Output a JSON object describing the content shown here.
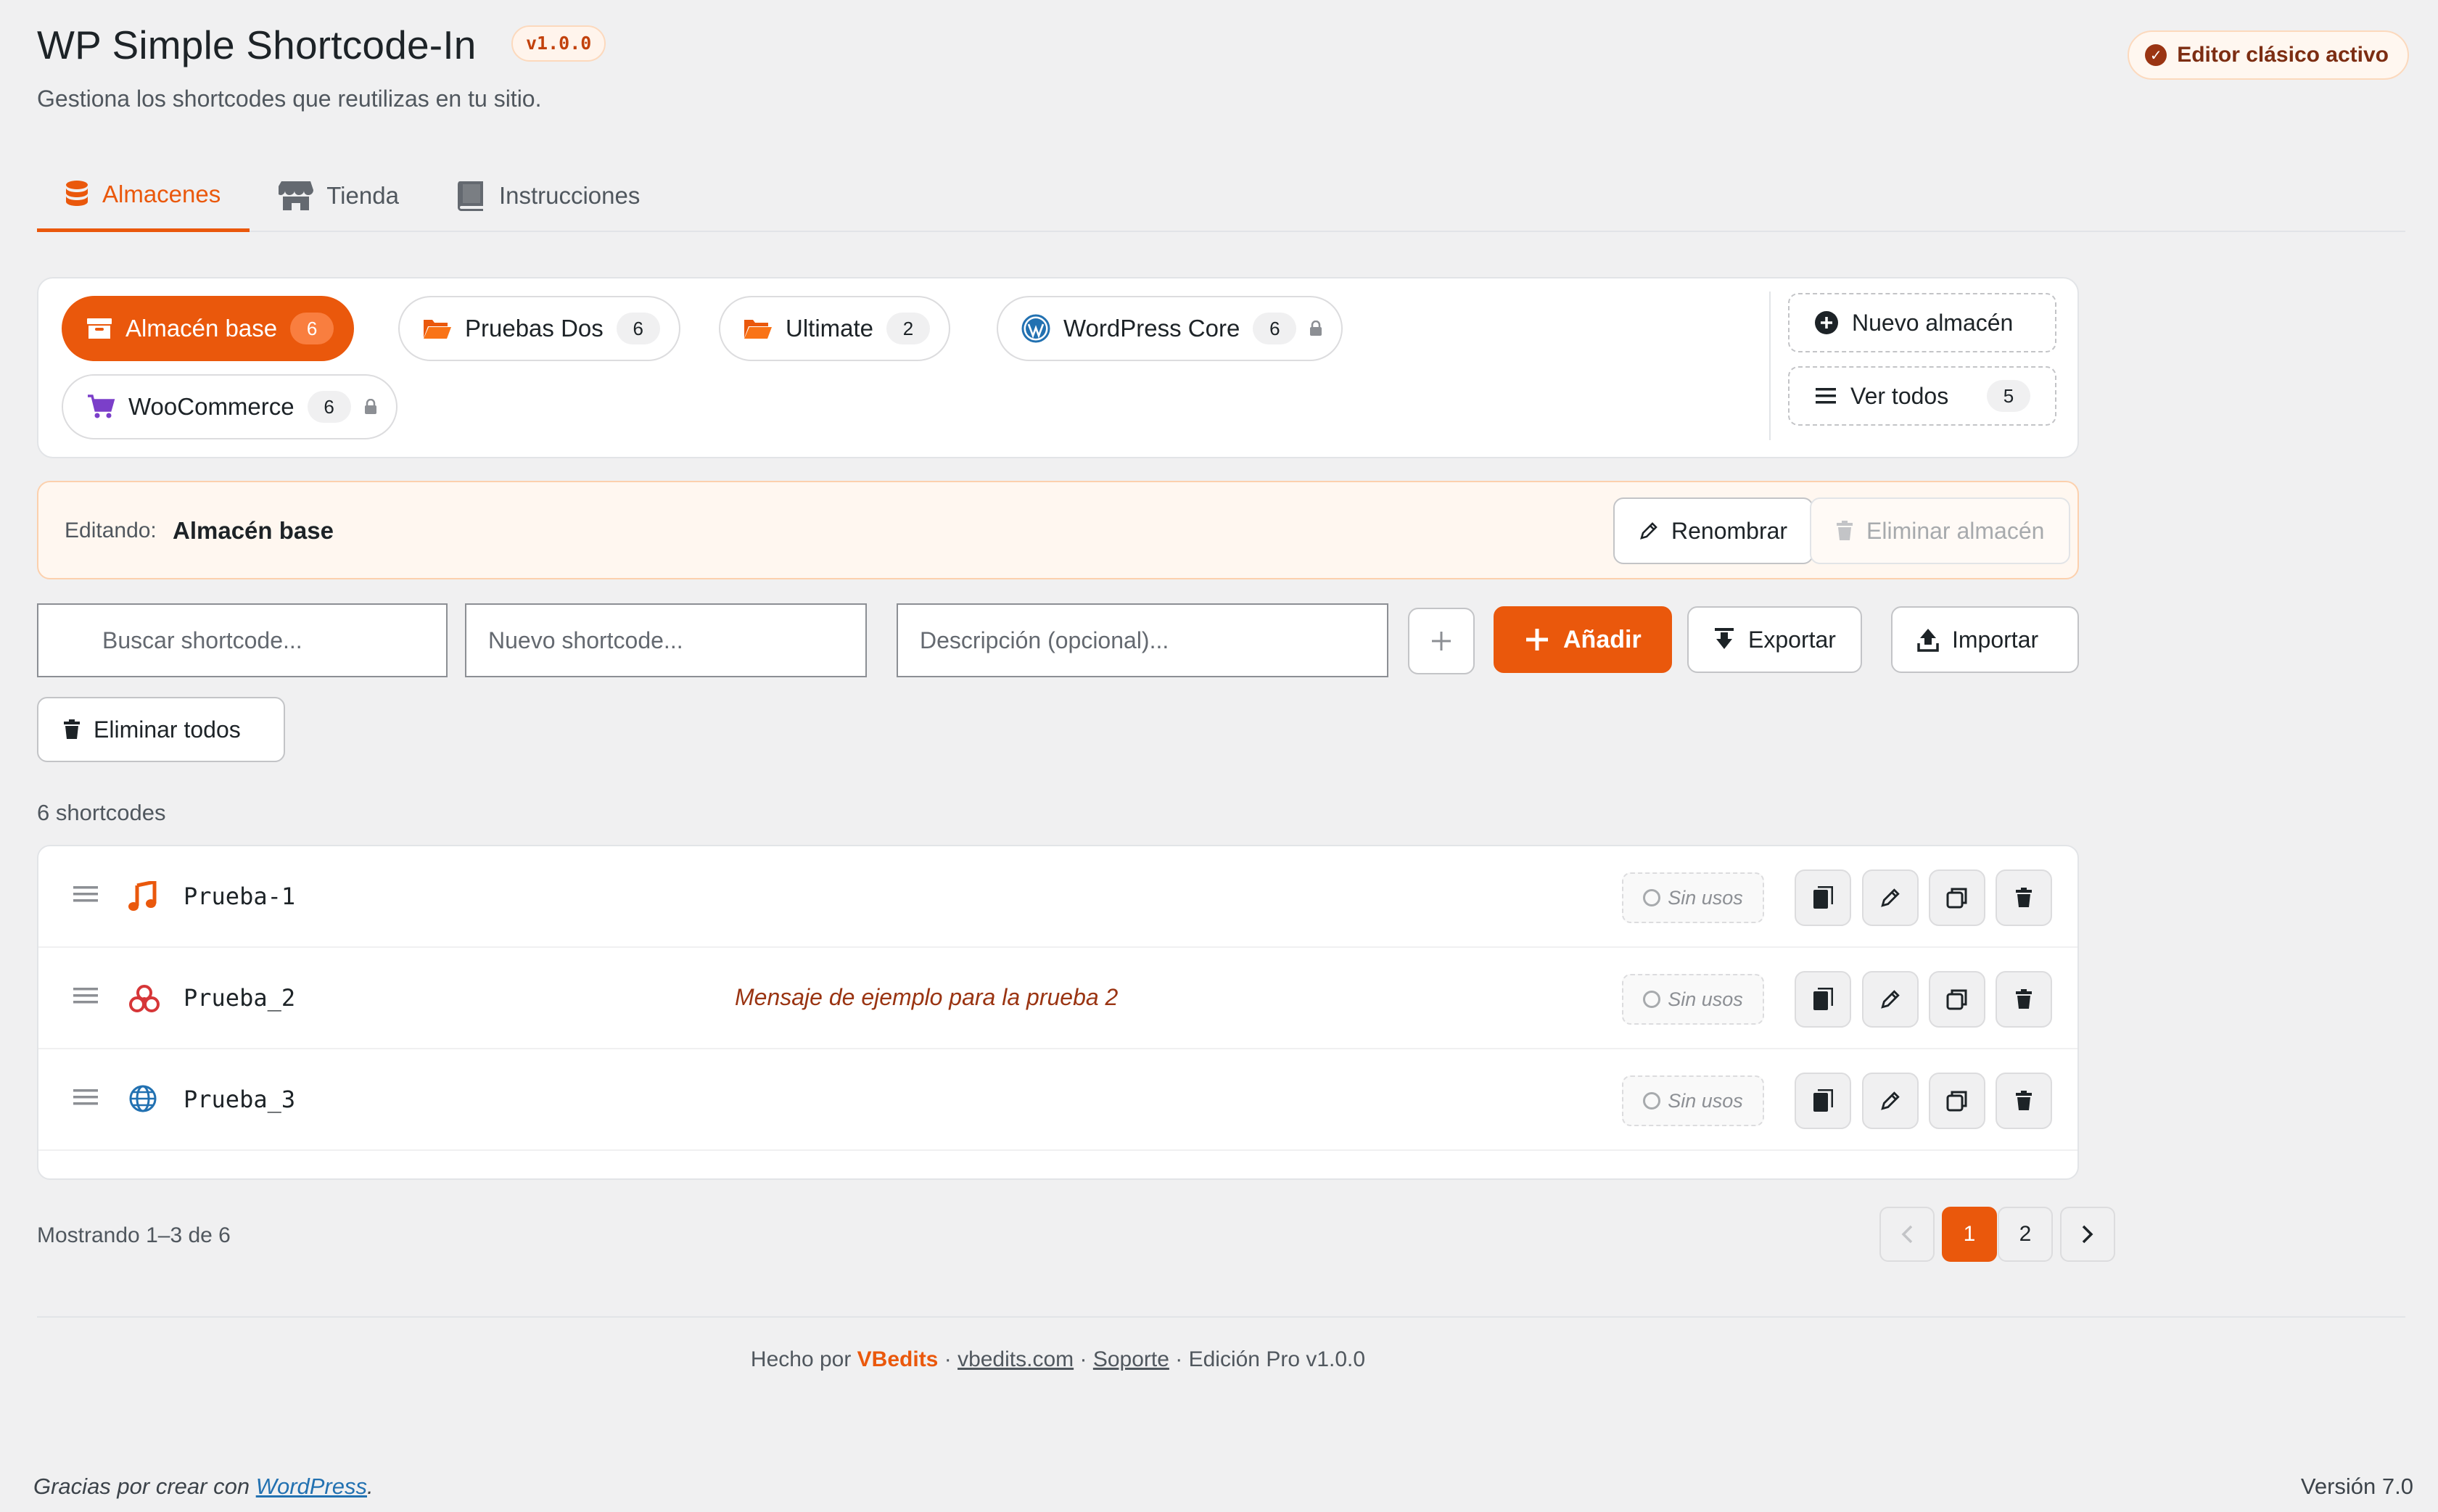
{
  "header": {
    "title": "WP Simple Shortcode-In",
    "version_badge": "v1.0.0",
    "subtitle": "Gestiona los shortcodes que reutilizas en tu sitio.",
    "editor_badge": "Editor clásico activo"
  },
  "tabs": [
    {
      "label": "Almacenes",
      "icon": "database-icon",
      "active": true
    },
    {
      "label": "Tienda",
      "icon": "store-icon",
      "active": false
    },
    {
      "label": "Instrucciones",
      "icon": "book-icon",
      "active": false
    }
  ],
  "stores": [
    {
      "label": "Almacén base",
      "count": "6",
      "icon": "archive-box-icon",
      "active": true,
      "locked": false
    },
    {
      "label": "Pruebas Dos",
      "count": "6",
      "icon": "folder-open-icon",
      "active": false,
      "locked": false
    },
    {
      "label": "Ultimate",
      "count": "2",
      "icon": "folder-open-icon",
      "active": false,
      "locked": false
    },
    {
      "label": "WordPress Core",
      "count": "6",
      "icon": "wordpress-icon",
      "active": false,
      "locked": true
    },
    {
      "label": "WooCommerce",
      "count": "6",
      "icon": "cart-icon",
      "active": false,
      "locked": true
    }
  ],
  "stores_actions": {
    "new_store": "Nuevo almacén",
    "view_all": "Ver todos",
    "view_all_count": "5"
  },
  "editing": {
    "label": "Editando:",
    "value": "Almacén base",
    "rename": "Renombrar",
    "delete_store": "Eliminar almacén"
  },
  "form": {
    "search_placeholder": "Buscar shortcode...",
    "new_placeholder": "Nuevo shortcode...",
    "description_placeholder": "Descripción (opcional)...",
    "add": "Añadir",
    "export": "Exportar",
    "import": "Importar",
    "delete_all": "Eliminar todos"
  },
  "list": {
    "count_label": "6 shortcodes",
    "usage_label": "Sin usos",
    "items": [
      {
        "name": "Prueba-1",
        "description": "",
        "icon": "music-note-icon",
        "icon_color": "#ea580c"
      },
      {
        "name": "Prueba_2",
        "description": "Mensaje de ejemplo para la prueba 2",
        "icon": "biohazard-icon",
        "icon_color": "#d63638"
      },
      {
        "name": "Prueba_3",
        "description": "",
        "icon": "globe-icon",
        "icon_color": "#2271b1"
      }
    ]
  },
  "pagination": {
    "showing": "Mostrando 1–3 de 6",
    "pages": [
      "1",
      "2"
    ],
    "current": "1"
  },
  "footer": {
    "made_by": "Hecho por",
    "brand": "VBedits",
    "site": "vbedits.com",
    "support": "Soporte",
    "edition": "Edición Pro v1.0.0",
    "sep": "·"
  },
  "wp_footer": {
    "thanks_prefix": "Gracias por crear con",
    "thanks_link": "WordPress",
    "thanks_suffix": ".",
    "version": "Versión 7.0"
  },
  "colors": {
    "accent": "#ea580c",
    "background": "#f0f0f1",
    "description_text": "#9a3412"
  }
}
